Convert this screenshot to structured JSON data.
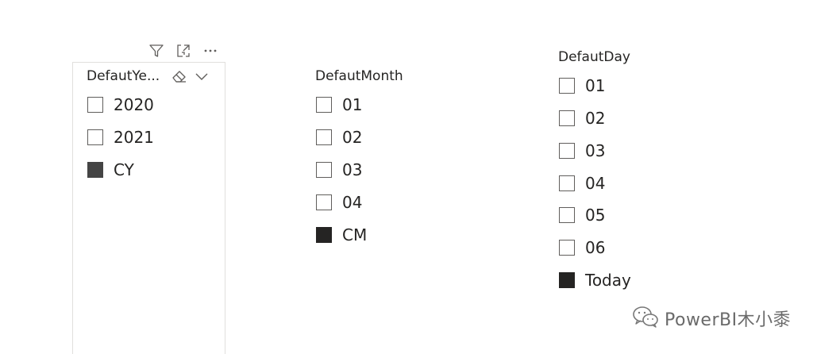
{
  "visual_header": {
    "icons": [
      "filter-icon",
      "focus-mode-icon",
      "more-options-icon"
    ]
  },
  "slicers": {
    "year": {
      "title": "DefautYe...",
      "items": [
        {
          "label": "2020",
          "checked": false
        },
        {
          "label": "2021",
          "checked": false
        },
        {
          "label": "CY",
          "checked": true
        }
      ]
    },
    "month": {
      "title": "DefautMonth",
      "items": [
        {
          "label": "01",
          "checked": false
        },
        {
          "label": "02",
          "checked": false
        },
        {
          "label": "03",
          "checked": false
        },
        {
          "label": "04",
          "checked": false
        },
        {
          "label": "CM",
          "checked": true
        }
      ]
    },
    "day": {
      "title": "DefautDay",
      "items": [
        {
          "label": "01",
          "checked": false
        },
        {
          "label": "02",
          "checked": false
        },
        {
          "label": "03",
          "checked": false
        },
        {
          "label": "04",
          "checked": false
        },
        {
          "label": "05",
          "checked": false
        },
        {
          "label": "06",
          "checked": false
        },
        {
          "label": "Today",
          "checked": true
        }
      ]
    }
  },
  "watermark": {
    "text": "PowerBI木小黍"
  }
}
